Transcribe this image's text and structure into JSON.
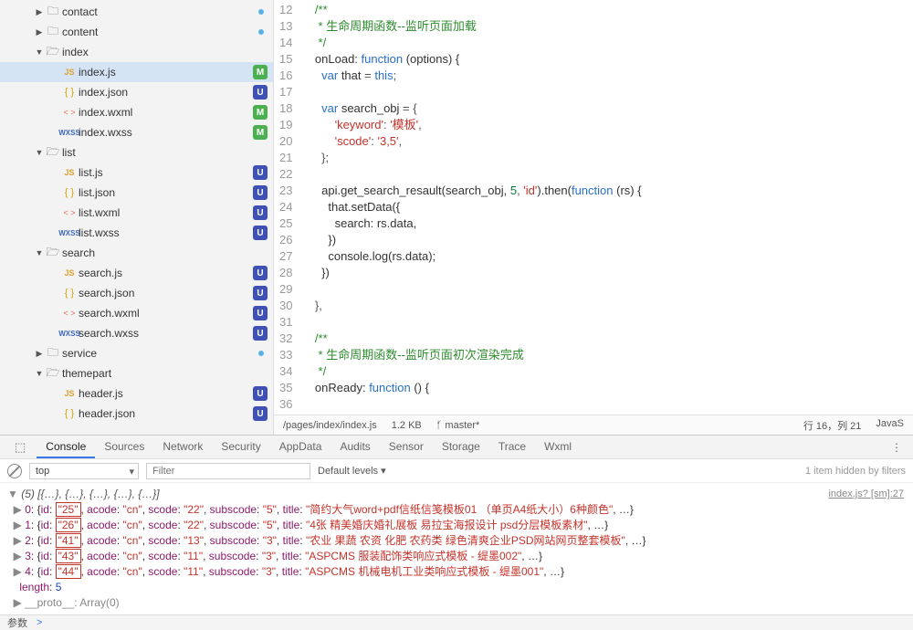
{
  "sidebar": {
    "items": [
      {
        "depth": 1,
        "arrow": "▶",
        "type": "folder",
        "name": "contact",
        "dot": true
      },
      {
        "depth": 1,
        "arrow": "▶",
        "type": "folder",
        "name": "content",
        "dot": true
      },
      {
        "depth": 1,
        "arrow": "▼",
        "type": "folder-open",
        "name": "index"
      },
      {
        "depth": 2,
        "type": "js",
        "name": "index.js",
        "badge": "M",
        "active": true
      },
      {
        "depth": 2,
        "type": "json",
        "name": "index.json",
        "badge": "U"
      },
      {
        "depth": 2,
        "type": "wxml",
        "name": "index.wxml",
        "badge": "M"
      },
      {
        "depth": 2,
        "type": "wxss",
        "name": "index.wxss",
        "badge": "M"
      },
      {
        "depth": 1,
        "arrow": "▼",
        "type": "folder-open",
        "name": "list"
      },
      {
        "depth": 2,
        "type": "js",
        "name": "list.js",
        "badge": "U"
      },
      {
        "depth": 2,
        "type": "json",
        "name": "list.json",
        "badge": "U"
      },
      {
        "depth": 2,
        "type": "wxml",
        "name": "list.wxml",
        "badge": "U"
      },
      {
        "depth": 2,
        "type": "wxss",
        "name": "list.wxss",
        "badge": "U"
      },
      {
        "depth": 1,
        "arrow": "▼",
        "type": "folder-open",
        "name": "search"
      },
      {
        "depth": 2,
        "type": "js",
        "name": "search.js",
        "badge": "U"
      },
      {
        "depth": 2,
        "type": "json",
        "name": "search.json",
        "badge": "U"
      },
      {
        "depth": 2,
        "type": "wxml",
        "name": "search.wxml",
        "badge": "U"
      },
      {
        "depth": 2,
        "type": "wxss",
        "name": "search.wxss",
        "badge": "U"
      },
      {
        "depth": 1,
        "arrow": "▶",
        "type": "folder",
        "name": "service",
        "dot": true
      },
      {
        "depth": 1,
        "arrow": "▼",
        "type": "folder-open",
        "name": "themepart"
      },
      {
        "depth": 2,
        "type": "js",
        "name": "header.js",
        "badge": "U"
      },
      {
        "depth": 2,
        "type": "json",
        "name": "header.json",
        "badge": "U"
      }
    ]
  },
  "editor": {
    "startLine": 12,
    "lines": [
      [
        {
          "t": "    ",
          "c": ""
        },
        {
          "t": "/**",
          "c": "c-comment"
        }
      ],
      [
        {
          "t": "     * 生命周期函数--监听页面加载",
          "c": "c-comment"
        }
      ],
      [
        {
          "t": "     */",
          "c": "c-comment"
        }
      ],
      [
        {
          "t": "    onLoad: ",
          "c": "c-ident"
        },
        {
          "t": "function",
          "c": "c-key"
        },
        {
          "t": " (options) {",
          "c": "c-ident"
        }
      ],
      [
        {
          "t": "      ",
          "c": ""
        },
        {
          "t": "var",
          "c": "c-key"
        },
        {
          "t": " that ",
          "c": "c-ident"
        },
        {
          "t": "=",
          "c": "c-punc"
        },
        {
          "t": " ",
          "c": ""
        },
        {
          "t": "this",
          "c": "c-key"
        },
        {
          "t": ";",
          "c": "c-punc"
        }
      ],
      [
        {
          "t": "",
          "c": ""
        }
      ],
      [
        {
          "t": "      ",
          "c": ""
        },
        {
          "t": "var",
          "c": "c-key"
        },
        {
          "t": " search_obj ",
          "c": "c-ident"
        },
        {
          "t": "=",
          "c": "c-punc"
        },
        {
          "t": " {",
          "c": "c-punc"
        }
      ],
      [
        {
          "t": "          ",
          "c": ""
        },
        {
          "t": "'keyword'",
          "c": "c-str"
        },
        {
          "t": ": ",
          "c": "c-punc"
        },
        {
          "t": "'模板'",
          "c": "c-str"
        },
        {
          "t": ",",
          "c": "c-punc"
        }
      ],
      [
        {
          "t": "          ",
          "c": ""
        },
        {
          "t": "'scode'",
          "c": "c-str"
        },
        {
          "t": ": ",
          "c": "c-punc"
        },
        {
          "t": "'3,5'",
          "c": "c-str"
        },
        {
          "t": ",",
          "c": "c-punc"
        }
      ],
      [
        {
          "t": "      };",
          "c": "c-punc"
        }
      ],
      [
        {
          "t": "",
          "c": ""
        }
      ],
      [
        {
          "t": "      api.get_search_resault(search_obj, ",
          "c": "c-ident"
        },
        {
          "t": "5",
          "c": "c-num"
        },
        {
          "t": ", ",
          "c": "c-punc"
        },
        {
          "t": "'id'",
          "c": "c-str"
        },
        {
          "t": ").then(",
          "c": "c-ident"
        },
        {
          "t": "function",
          "c": "c-key"
        },
        {
          "t": " (rs) {",
          "c": "c-ident"
        }
      ],
      [
        {
          "t": "        that.setData({",
          "c": "c-ident"
        }
      ],
      [
        {
          "t": "          search: rs.data,",
          "c": "c-ident"
        }
      ],
      [
        {
          "t": "        })",
          "c": "c-ident"
        }
      ],
      [
        {
          "t": "        console.log(rs.data);",
          "c": "c-ident"
        }
      ],
      [
        {
          "t": "      })",
          "c": "c-ident"
        }
      ],
      [
        {
          "t": "",
          "c": ""
        }
      ],
      [
        {
          "t": "    },",
          "c": "c-punc"
        }
      ],
      [
        {
          "t": "",
          "c": ""
        }
      ],
      [
        {
          "t": "    ",
          "c": ""
        },
        {
          "t": "/**",
          "c": "c-comment"
        }
      ],
      [
        {
          "t": "     * 生命周期函数--监听页面初次渲染完成",
          "c": "c-comment"
        }
      ],
      [
        {
          "t": "     */",
          "c": "c-comment"
        }
      ],
      [
        {
          "t": "    onReady: ",
          "c": "c-ident"
        },
        {
          "t": "function",
          "c": "c-key"
        },
        {
          "t": " () {",
          "c": "c-ident"
        }
      ],
      [
        {
          "t": "",
          "c": ""
        }
      ]
    ]
  },
  "status": {
    "path": "/pages/index/index.js",
    "size": "1.2 KB",
    "branch": "master*",
    "cursor": "行 16，列 21",
    "lang": "JavaS"
  },
  "devtools": {
    "tabs": [
      "Console",
      "Sources",
      "Network",
      "Security",
      "AppData",
      "Audits",
      "Sensor",
      "Storage",
      "Trace",
      "Wxml"
    ],
    "activeTab": "Console",
    "context": "top",
    "filterPlaceholder": "Filter",
    "levels": "Default levels ▾",
    "hidden": "1 item hidden by filters",
    "sourceLink": "index.js? [sm]:27",
    "arrayHeader": "(5) [{…}, {…}, {…}, {…}, {…}]",
    "rows": [
      {
        "idx": "0",
        "id": "25",
        "acode": "cn",
        "scode": "22",
        "subscode": "5",
        "title": "简约大气word+pdf信纸信笺模板01 （单页A4纸大小）6种颜色"
      },
      {
        "idx": "1",
        "id": "26",
        "acode": "cn",
        "scode": "22",
        "subscode": "5",
        "title": "4张 精美婚庆婚礼展板 易拉宝海报设计 psd分层模板素材"
      },
      {
        "idx": "2",
        "id": "41",
        "acode": "cn",
        "scode": "13",
        "subscode": "3",
        "title": "农业 果蔬 农资 化肥 农药类 绿色清爽企业PSD网站网页整套模板"
      },
      {
        "idx": "3",
        "id": "43",
        "acode": "cn",
        "scode": "11",
        "subscode": "3",
        "title": "ASPCMS 服装配饰类响应式模板 - 缇墨002"
      },
      {
        "idx": "4",
        "id": "44",
        "acode": "cn",
        "scode": "11",
        "subscode": "3",
        "title": "ASPCMS 机械电机工业类响应式模板 - 缇墨001"
      }
    ],
    "length": "5",
    "proto": "__proto__: Array(0)"
  },
  "footer": {
    "label": "参数",
    "prompt": ">"
  }
}
